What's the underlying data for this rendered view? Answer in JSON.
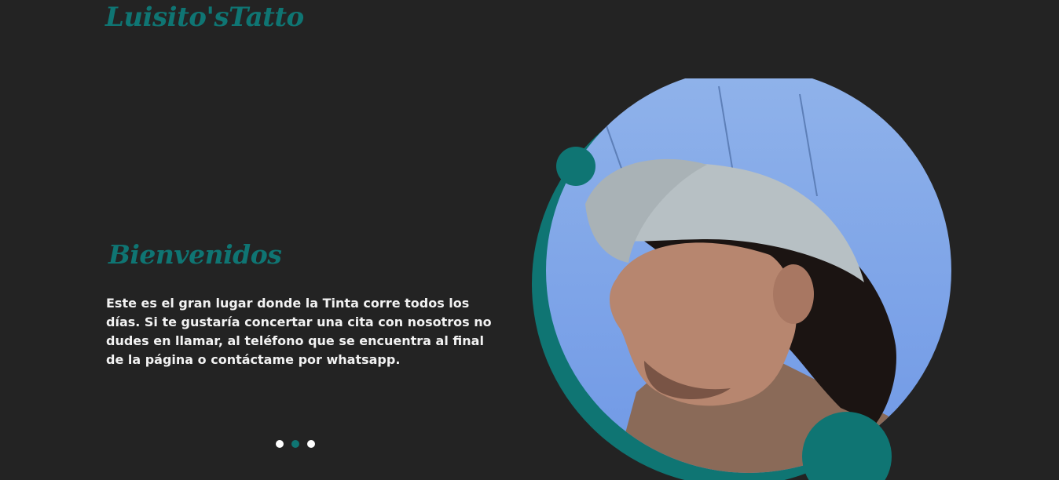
{
  "header": {
    "logo_text": "Luisito'sTatto"
  },
  "hero": {
    "title": "Bienvenidos",
    "description": "Este es el gran lugar donde la Tinta corre todos los días. Si te gustaría concertar una cita con nosotros no dudes en llamar, al teléfono que se encuentra al final de la página o contáctame por whatsapp.",
    "image_alt": "Retrato de joven con gorra"
  },
  "carousel": {
    "slide_count": 3,
    "active_index": 1
  },
  "colors": {
    "background": "#232323",
    "accent": "#0f7573",
    "text": "#f2f2f2"
  }
}
